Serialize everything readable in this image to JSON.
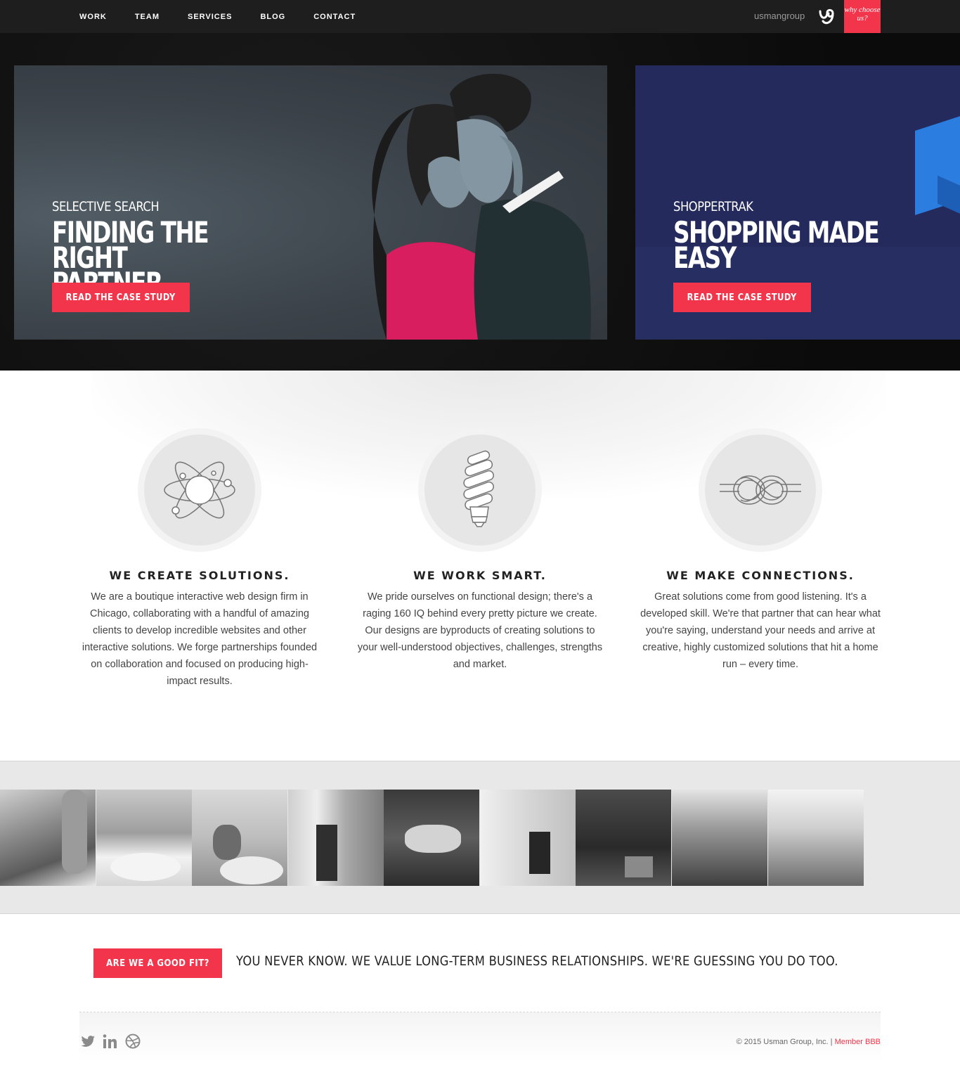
{
  "nav": {
    "items": [
      "WORK",
      "TEAM",
      "SERVICES",
      "BLOG",
      "CONTACT"
    ],
    "brand": "usmangroup",
    "ribbon": "why choose us?"
  },
  "hero": {
    "slides": [
      {
        "kicker": "SELECTIVE SEARCH",
        "title": "FINDING THE RIGHT\nPARTNER",
        "button": "READ THE CASE STUDY"
      },
      {
        "kicker": "SHOPPERTRAK",
        "title": "SHOPPING MADE\nEASY",
        "button": "READ THE CASE STUDY"
      }
    ]
  },
  "features": [
    {
      "icon": "atom-icon",
      "title": "WE CREATE SOLUTIONS.",
      "text": "We are a boutique interactive web design firm in Chicago, collaborating with a handful of amazing clients to develop incredible websites and other interactive solutions. We forge partnerships founded on collaboration and focused on producing high-impact results."
    },
    {
      "icon": "lightbulb-icon",
      "title": "WE WORK SMART.",
      "text": "We pride ourselves on functional design; there's a raging 160 IQ behind every pretty picture we create. Our designs are byproducts of creating solutions to your well-understood objectives, challenges, strengths and market."
    },
    {
      "icon": "knot-icon",
      "title": "WE MAKE CONNECTIONS.",
      "text": "Great solutions come from good listening. It's a developed skill. We're that partner that can hear what you're saying, understand your needs and arrive at creative, highly customized solutions that hit a home run – every time."
    }
  ],
  "cta": {
    "button": "ARE WE A GOOD FIT?",
    "text": "YOU NEVER KNOW. WE VALUE LONG-TERM BUSINESS RELATIONSHIPS. WE'RE GUESSING YOU DO TOO."
  },
  "footer": {
    "copyright": "© 2015 Usman Group, Inc. | ",
    "bbb": "Member BBB",
    "social": [
      "twitter-icon",
      "linkedin-icon",
      "dribbble-icon"
    ]
  },
  "colors": {
    "accent": "#f2354a",
    "nav_bg": "#1e1e1e",
    "hero_bg": "#111111",
    "slide2_bg": "#242b5c"
  }
}
